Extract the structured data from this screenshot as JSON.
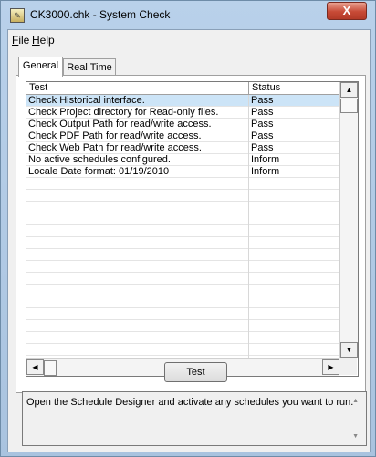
{
  "window": {
    "title": "CK3000.chk - System Check",
    "close_glyph": "X"
  },
  "menu": {
    "file_accel": "F",
    "file_rest": "ile",
    "help_accel": "H",
    "help_rest": "elp"
  },
  "tabs": [
    {
      "label": "General",
      "active": true
    },
    {
      "label": "Real Time",
      "active": false
    }
  ],
  "table": {
    "columns": [
      "Test",
      "Status"
    ],
    "rows": [
      {
        "test": "Check Historical interface.",
        "status": "Pass",
        "selected": true
      },
      {
        "test": "Check Project directory for Read-only files.",
        "status": "Pass",
        "selected": false
      },
      {
        "test": "Check Output Path for read/write access.",
        "status": "Pass",
        "selected": false
      },
      {
        "test": "Check PDF Path for read/write access.",
        "status": "Pass",
        "selected": false
      },
      {
        "test": "Check Web Path for read/write access.",
        "status": "Pass",
        "selected": false
      },
      {
        "test": "No active schedules configured.",
        "status": "Inform",
        "selected": false
      },
      {
        "test": "Locale Date format:  01/19/2010",
        "status": "Inform",
        "selected": false
      }
    ],
    "empty_rows": 17
  },
  "buttons": {
    "test": "Test"
  },
  "message": "Open the Schedule Designer and activate any schedules you want to run."
}
